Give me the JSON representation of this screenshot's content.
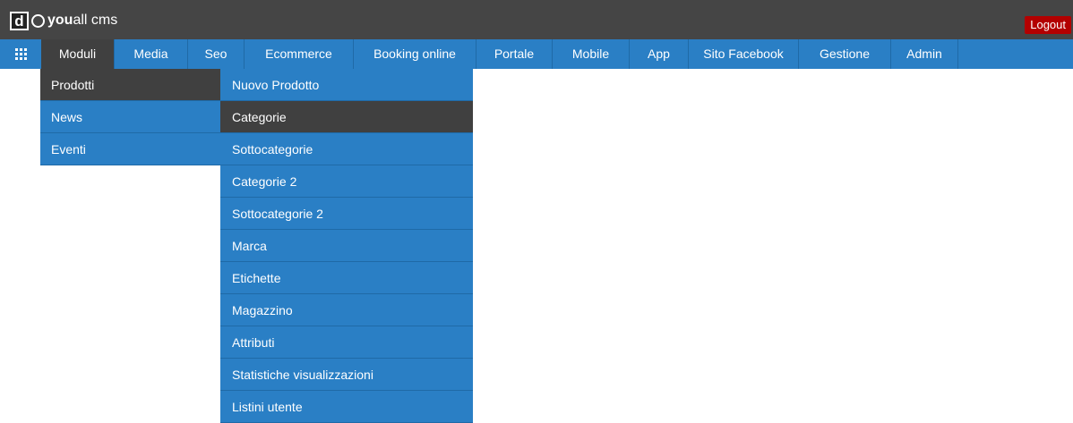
{
  "app": {
    "logo_letter": "d",
    "brand_bold": "you",
    "brand_rest": "all cms",
    "logout_label": "Logout"
  },
  "nav": {
    "items": [
      {
        "label": "Moduli",
        "active": true
      },
      {
        "label": "Media"
      },
      {
        "label": "Seo"
      },
      {
        "label": "Ecommerce"
      },
      {
        "label": "Booking online"
      },
      {
        "label": "Portale"
      },
      {
        "label": "Mobile"
      },
      {
        "label": "App"
      },
      {
        "label": "Sito Facebook"
      },
      {
        "label": "Gestione"
      },
      {
        "label": "Admin"
      }
    ]
  },
  "submenu": {
    "items": [
      {
        "label": "Prodotti",
        "active": true
      },
      {
        "label": "News"
      },
      {
        "label": "Eventi"
      }
    ]
  },
  "products_menu": {
    "items": [
      {
        "label": "Nuovo Prodotto"
      },
      {
        "label": "Categorie",
        "active": true
      },
      {
        "label": "Sottocategorie"
      },
      {
        "label": "Categorie 2"
      },
      {
        "label": "Sottocategorie 2"
      },
      {
        "label": "Marca"
      },
      {
        "label": "Etichette"
      },
      {
        "label": "Magazzino"
      },
      {
        "label": "Attributi"
      },
      {
        "label": "Statistiche visualizzazioni"
      },
      {
        "label": "Listini utente"
      }
    ]
  },
  "colors": {
    "topbar": "#454545",
    "nav_blue": "#2a7fc5",
    "active_dark": "#404040",
    "logout_red": "#b30000"
  },
  "icons": {
    "apps": "grid-icon"
  }
}
